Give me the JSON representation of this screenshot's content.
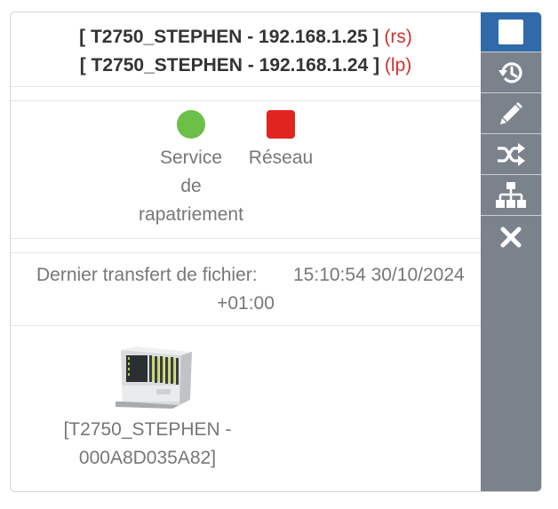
{
  "header": {
    "line1_name": "[ T2750_STEPHEN - 192.168.1.25 ]",
    "line1_role": "(rs)",
    "line2_name": "[ T2750_STEPHEN - 192.168.1.24 ]",
    "line2_role": "(lp)"
  },
  "status": {
    "service": {
      "label_line1": "Service",
      "label_line2": "de",
      "label_line3": "rapatriement",
      "state": "ok",
      "color": "#6cbf47"
    },
    "network": {
      "label": "Réseau",
      "state": "error",
      "color": "#e0251f"
    }
  },
  "transfer": {
    "label": "Dernier transfert de fichier:",
    "time": "15:10:54 30/10/2024",
    "timezone": "+01:00"
  },
  "device": {
    "label_line1": "[T2750_STEPHEN -",
    "label_line2": "000A8D035A82]"
  },
  "toolbar": {
    "buttons": [
      {
        "icon": "stop-square-icon",
        "active": true
      },
      {
        "icon": "history-icon",
        "active": false
      },
      {
        "icon": "pencil-icon",
        "active": false
      },
      {
        "icon": "shuffle-icon",
        "active": false
      },
      {
        "icon": "sitemap-icon",
        "active": false
      },
      {
        "icon": "close-icon",
        "active": false
      }
    ],
    "colors": {
      "background": "#7a828c",
      "active": "#2f6bab"
    }
  }
}
